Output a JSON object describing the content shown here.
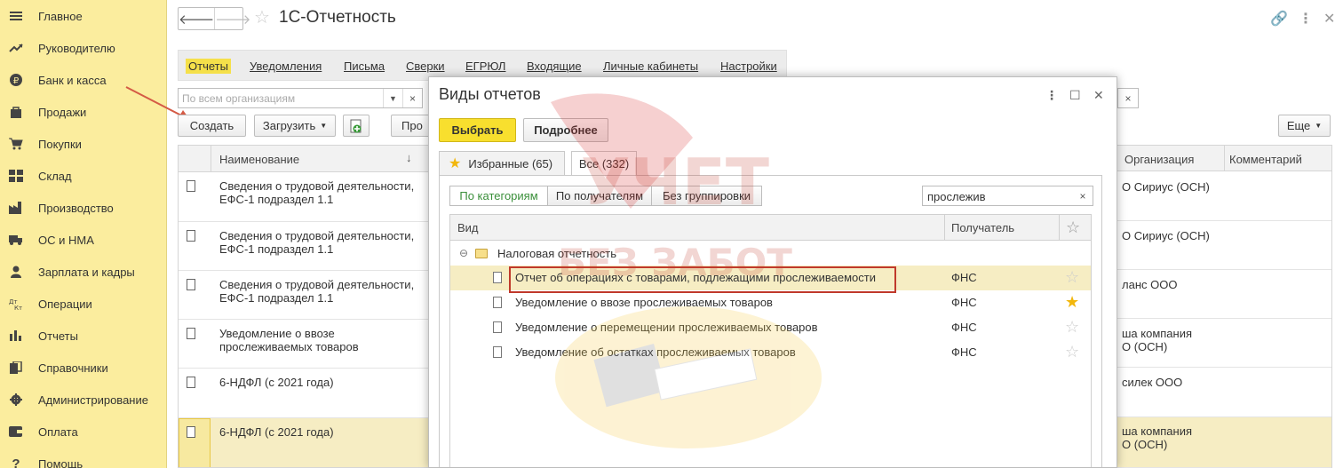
{
  "sidebar": {
    "items": [
      {
        "label": "Главное",
        "icon": "menu-icon"
      },
      {
        "label": "Руководителю",
        "icon": "trend-icon"
      },
      {
        "label": "Банк и касса",
        "icon": "ruble-icon"
      },
      {
        "label": "Продажи",
        "icon": "bag-icon"
      },
      {
        "label": "Покупки",
        "icon": "cart-icon"
      },
      {
        "label": "Склад",
        "icon": "warehouse-icon"
      },
      {
        "label": "Производство",
        "icon": "factory-icon"
      },
      {
        "label": "ОС и НМА",
        "icon": "truck-icon"
      },
      {
        "label": "Зарплата и кадры",
        "icon": "person-icon"
      },
      {
        "label": "Операции",
        "icon": "dt-kt-icon"
      },
      {
        "label": "Отчеты",
        "icon": "bar-chart-icon"
      },
      {
        "label": "Справочники",
        "icon": "books-icon"
      },
      {
        "label": "Администрирование",
        "icon": "gear-icon"
      },
      {
        "label": "Оплата",
        "icon": "wallet-icon"
      },
      {
        "label": "Помощь",
        "icon": "help-icon"
      }
    ]
  },
  "header": {
    "title": "1С-Отчетность"
  },
  "tabs": [
    {
      "label": "Отчеты"
    },
    {
      "label": "Уведомления"
    },
    {
      "label": "Письма"
    },
    {
      "label": "Сверки"
    },
    {
      "label": "ЕГРЮЛ"
    },
    {
      "label": "Входящие"
    },
    {
      "label": "Личные кабинеты"
    },
    {
      "label": "Настройки"
    }
  ],
  "filter": {
    "placeholder": "По всем организациям",
    "clear": "×"
  },
  "toolbar": {
    "create": "Создать",
    "load": "Загрузить",
    "check": "Про",
    "more": "Еще"
  },
  "list": {
    "col_name": "Наименование",
    "col_org": "Организация",
    "col_comment": "Комментарий",
    "rows": [
      {
        "name": "Сведения о трудовой деятельности, ЕФС-1 подраздел 1.1",
        "org": "О Сириус (ОСН)"
      },
      {
        "name": "Сведения о трудовой деятельности, ЕФС-1 подраздел 1.1",
        "org": "О Сириус (ОСН)"
      },
      {
        "name": "Сведения о трудовой деятельности, ЕФС-1 подраздел 1.1",
        "org": "ланс ООО"
      },
      {
        "name": "Уведомление о ввозе прослеживаемых товаров",
        "org": "ша компания\nО (ОСН)"
      },
      {
        "name": "6-НДФЛ (с 2021 года)",
        "org": "силек ООО"
      },
      {
        "name": "6-НДФЛ (с 2021 года)",
        "org": "ша компания\nО (ОСН)"
      }
    ]
  },
  "modal": {
    "title": "Виды отчетов",
    "select": "Выбрать",
    "details": "Подробнее",
    "tab_fav": "Избранные (65)",
    "tab_all": "Все (332)",
    "seg_category": "По категориям",
    "seg_recipient": "По получателям",
    "seg_none": "Без группировки",
    "search_value": "прослежив",
    "col_kind": "Вид",
    "col_recipient": "Получатель",
    "group": "Налоговая отчетность",
    "rows": [
      {
        "name": "Отчет об операциях с товарами, подлежащими прослеживаемости",
        "recipient": "ФНС",
        "fav": false
      },
      {
        "name": "Уведомление о ввозе прослеживаемых товаров",
        "recipient": "ФНС",
        "fav": true
      },
      {
        "name": "Уведомление о перемещении прослеживаемых товаров",
        "recipient": "ФНС",
        "fav": false
      },
      {
        "name": "Уведомление об остатках прослеживаемых товаров",
        "recipient": "ФНС",
        "fav": false
      }
    ]
  },
  "watermark": {
    "line1": "УЧЕТ",
    "line2": "БЕЗ ЗАБОТ"
  },
  "colors": {
    "sidebar": "#fbed9e",
    "accent": "#f8df2e",
    "highlight": "#c0392b",
    "selection": "#f6edc3"
  }
}
